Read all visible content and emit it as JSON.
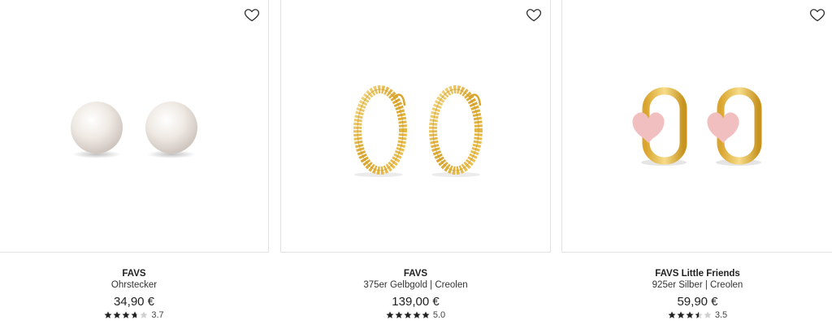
{
  "products": [
    {
      "brand": "FAVS",
      "description": "Ohrstecker",
      "price": "34,90 €",
      "rating_text": "3.7",
      "rating_value": 3.7,
      "image_icon": "pearl-stud-earrings"
    },
    {
      "brand": "FAVS",
      "description": "375er Gelbgold | Creolen",
      "price": "139,00 €",
      "rating_text": "5.0",
      "rating_value": 5.0,
      "image_icon": "gold-hoop-earrings"
    },
    {
      "brand": "FAVS Little Friends",
      "description": "925er Silber | Creolen",
      "price": "59,90 €",
      "rating_text": "3.5",
      "rating_value": 3.5,
      "image_icon": "heart-huggie-earrings"
    }
  ],
  "colors": {
    "gold": "#e3b43c",
    "pearl": "#efe9e3",
    "pink": "#f1bfbf",
    "star": "#222222",
    "star_empty": "#cfcfcf"
  }
}
